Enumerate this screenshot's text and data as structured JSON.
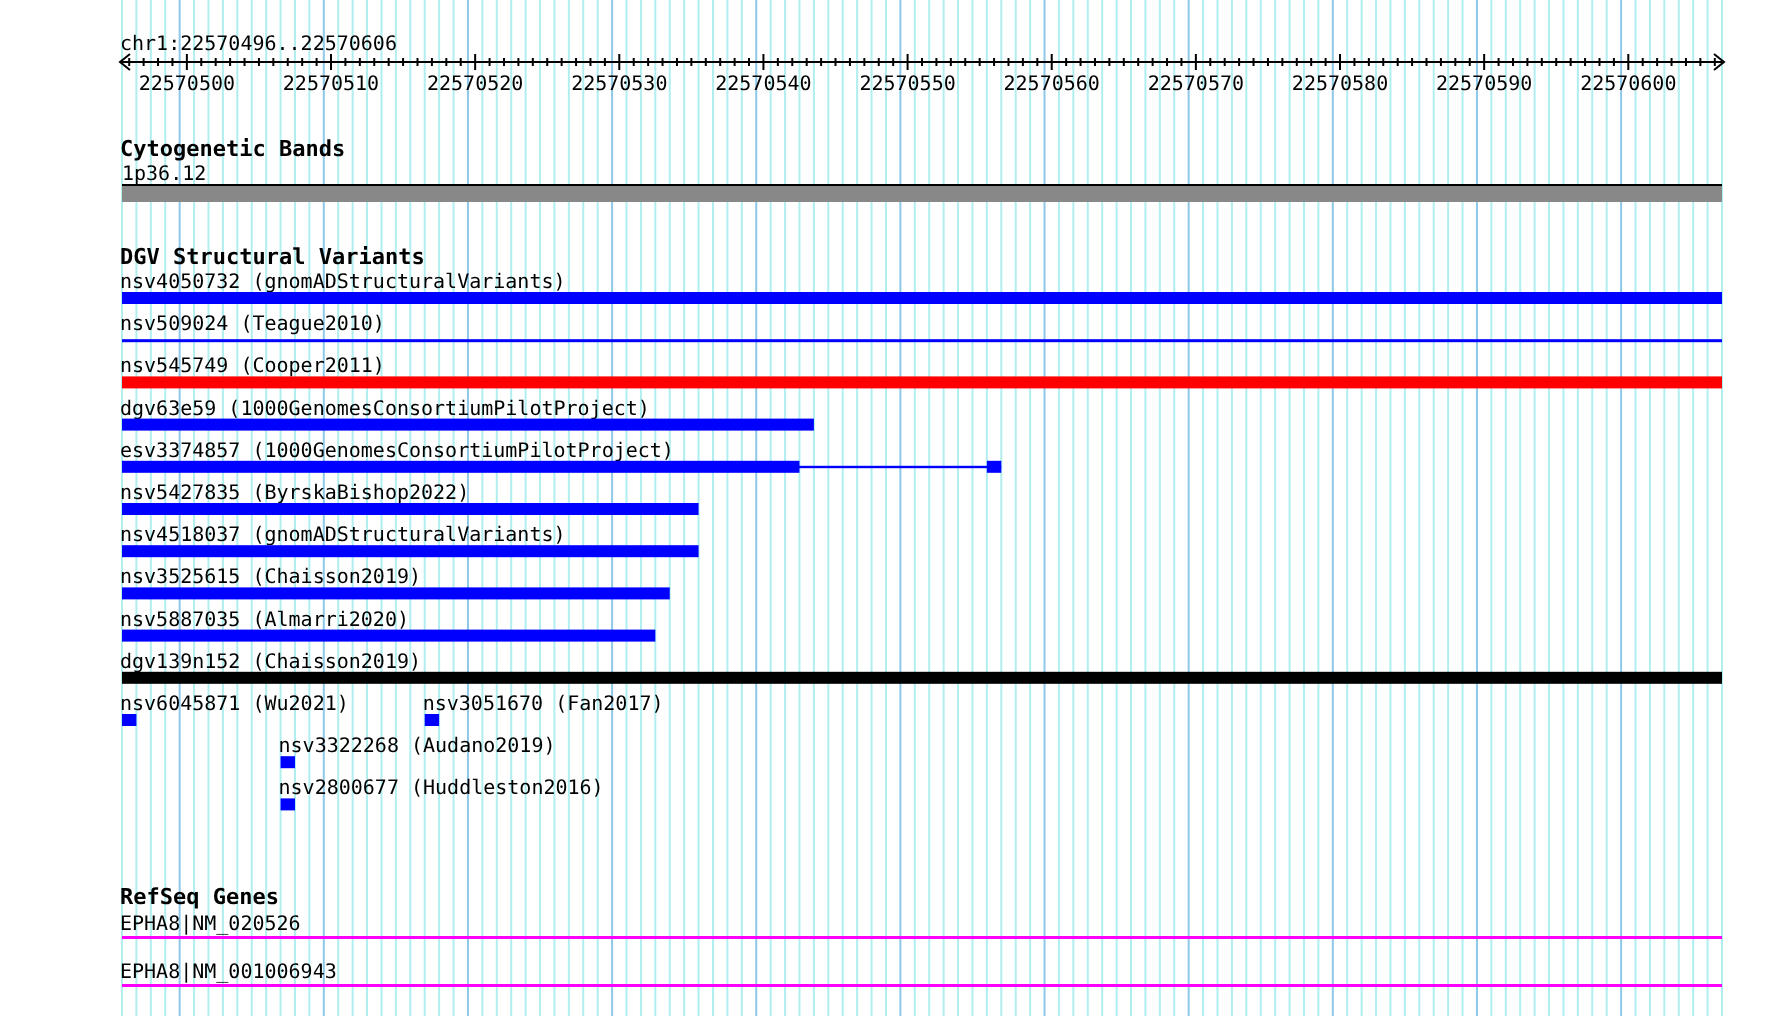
{
  "ruler": {
    "title": "chr1:22570496..22570606",
    "tick_labels": [
      "22570500",
      "22570510",
      "22570520",
      "22570530",
      "22570540",
      "22570550",
      "22570560",
      "22570570",
      "22570580",
      "22570590",
      "22570600"
    ]
  },
  "cytogenetic_bands": {
    "title": "Cytogenetic Bands",
    "bands": [
      {
        "label": "1p36.12",
        "color": "#888888"
      }
    ]
  },
  "dgv_structural_variants": {
    "title": "DGV Structural Variants",
    "rows": [
      [
        {
          "label": "nsv4050732 (gnomADStructuralVariants)",
          "kind": "bar",
          "color": "#0000ff"
        }
      ],
      [
        {
          "label": "nsv509024 (Teague2010)",
          "kind": "line",
          "color": "#0000ff"
        }
      ],
      [
        {
          "label": "nsv545749 (Cooper2011)",
          "kind": "bar",
          "color": "#ff0000"
        }
      ],
      [
        {
          "label": "dgv63e59 (1000GenomesConsortiumPilotProject)",
          "kind": "bar",
          "color": "#0000ff"
        }
      ],
      [
        {
          "label": "esv3374857 (1000GenomesConsortiumPilotProject)",
          "kind": "split",
          "color": "#0000ff"
        }
      ],
      [
        {
          "label": "nsv5427835 (ByrskaBishop2022)",
          "kind": "bar",
          "color": "#0000ff"
        }
      ],
      [
        {
          "label": "nsv4518037 (gnomADStructuralVariants)",
          "kind": "bar",
          "color": "#0000ff"
        }
      ],
      [
        {
          "label": "nsv3525615 (Chaisson2019)",
          "kind": "bar",
          "color": "#0000ff"
        }
      ],
      [
        {
          "label": "nsv5887035 (Almarri2020)",
          "kind": "bar",
          "color": "#0000ff"
        }
      ],
      [
        {
          "label": "dgv139n152 (Chaisson2019)",
          "kind": "bar",
          "color": "#000000"
        }
      ],
      [
        {
          "label": "nsv6045871 (Wu2021)",
          "kind": "bar",
          "color": "#0000ff"
        },
        {
          "label": "nsv3051670 (Fan2017)",
          "kind": "bar",
          "color": "#0000ff"
        }
      ],
      [
        {
          "label": "nsv3322268 (Audano2019)",
          "kind": "bar",
          "color": "#0000ff"
        }
      ],
      [
        {
          "label": "nsv2800677 (Huddleston2016)",
          "kind": "bar",
          "color": "#0000ff"
        }
      ]
    ]
  },
  "refseq_genes": {
    "title": "RefSeq Genes",
    "genes": [
      {
        "label": "EPHA8|NM_020526",
        "color": "#ff00ff"
      },
      {
        "label": "EPHA8|NM_001006943",
        "color": "#ff00ff"
      }
    ]
  }
}
